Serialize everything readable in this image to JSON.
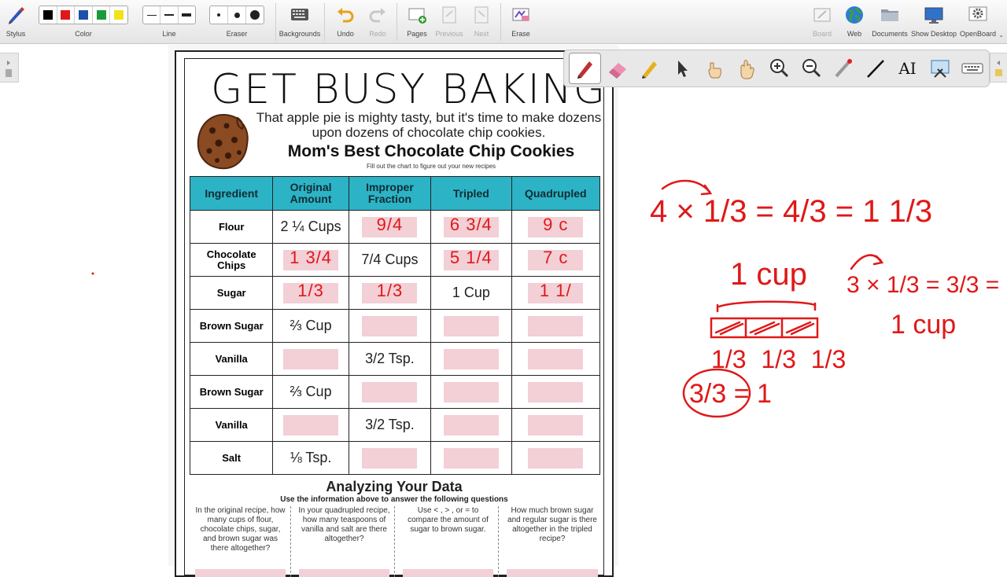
{
  "toolbar": {
    "stylus": "Stylus",
    "color": "Color",
    "line": "Line",
    "eraser": "Eraser",
    "backgrounds": "Backgrounds",
    "undo": "Undo",
    "redo": "Redo",
    "pages": "Pages",
    "previous": "Previous",
    "next": "Next",
    "erase": "Erase",
    "board": "Board",
    "web": "Web",
    "documents": "Documents",
    "show_desktop": "Show Desktop",
    "openboard": "OpenBoard",
    "colors": [
      "#000000",
      "#e01818",
      "#1f4fa8",
      "#1a9a3a",
      "#f2e21a"
    ]
  },
  "worksheet": {
    "title": "GET BUSY BAKING I",
    "intro": "That apple pie is mighty tasty, but it's time to make dozens upon dozens of chocolate chip cookies.",
    "subtitle": "Mom's Best Chocolate Chip Cookies",
    "instructions": "Fill out the chart to figure out your new recipes",
    "headers": [
      "Ingredient",
      "Original Amount",
      "Improper Fraction",
      "Tripled",
      "Quadrupled"
    ],
    "rows": [
      {
        "ingredient": "Flour",
        "original": "2 ¼ Cups",
        "improper": "",
        "tripled": "",
        "quadrupled": ""
      },
      {
        "ingredient": "Chocolate Chips",
        "original": "",
        "improper": "7/4 Cups",
        "tripled": "",
        "quadrupled": ""
      },
      {
        "ingredient": "Sugar",
        "original": "",
        "improper": "",
        "tripled": "1 Cup",
        "quadrupled": ""
      },
      {
        "ingredient": "Brown Sugar",
        "original": "⅔ Cup",
        "improper": "",
        "tripled": "",
        "quadrupled": ""
      },
      {
        "ingredient": "Vanilla",
        "original": "",
        "improper": "3/2 Tsp.",
        "tripled": "",
        "quadrupled": ""
      },
      {
        "ingredient": "Brown Sugar",
        "original": "⅔ Cup",
        "improper": "",
        "tripled": "",
        "quadrupled": ""
      },
      {
        "ingredient": "Vanilla",
        "original": "",
        "improper": "3/2 Tsp.",
        "tripled": "",
        "quadrupled": ""
      },
      {
        "ingredient": "Salt",
        "original": "⅛ Tsp.",
        "improper": "",
        "tripled": "",
        "quadrupled": ""
      }
    ],
    "handwritten": {
      "flour_improper": "9/4",
      "flour_tripled": "6 3/4",
      "flour_quadrupled": "9 c",
      "chips_original": "1 3/4",
      "chips_tripled": "5 1/4",
      "chips_quadrupled": "7 c",
      "sugar_original": "1/3",
      "sugar_improper": "1/3",
      "sugar_quadrupled": "1 1/"
    },
    "analyze_title": "Analyzing Your Data",
    "analyze_sub": "Use the information above to answer the following questions",
    "questions": [
      "In the original recipe, how many cups of flour, chocolate chips, sugar, and brown sugar was there altogether?",
      "In your quadrupled recipe, how many teaspoons of vanilla and salt are there altogether?",
      "Use < , > , or = to compare the amount of sugar to brown sugar.",
      "How much brown sugar and regular sugar is there altogether in the tripled recipe?"
    ]
  },
  "board_notes": {
    "eq1": "4 × 1/3 = 4/3 = 1 1/3",
    "cup_label": "1 cup",
    "thirds": "1/3  1/3  1/3",
    "circled": "3/3 = 1",
    "eq2": "3 × 1/3 = 3/3 =",
    "cup_label2": "1 cup"
  }
}
